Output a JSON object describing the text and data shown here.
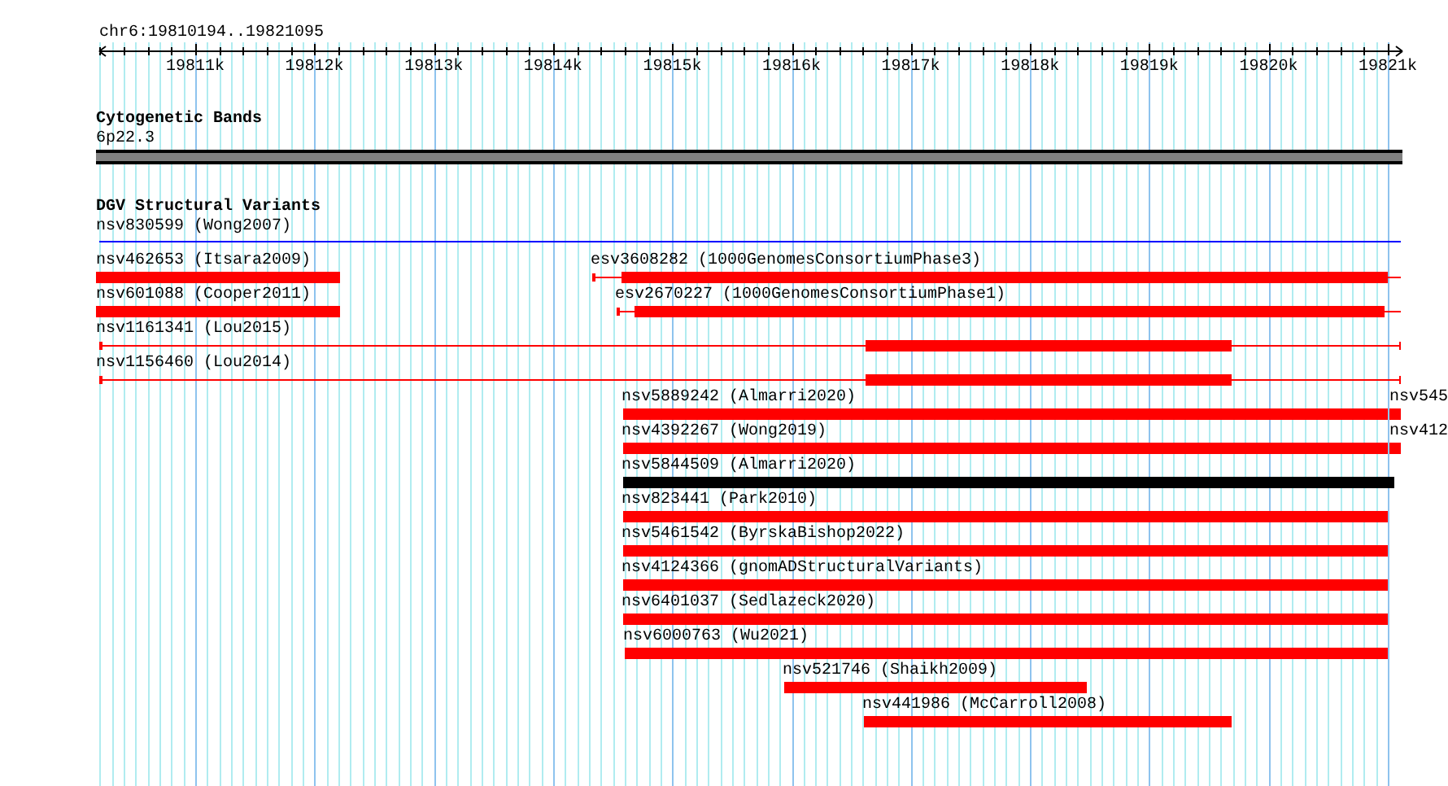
{
  "ruler": {
    "title": "chr6:19810194..19821095",
    "ticks": [
      "19811k",
      "19812k",
      "19813k",
      "19814k",
      "19815k",
      "19816k",
      "19817k",
      "19818k",
      "19819k",
      "19820k",
      "19821k"
    ]
  },
  "cytogenetic_bands": {
    "title": "Cytogenetic Bands",
    "band": "6p22.3"
  },
  "structural_variants": {
    "title": "DGV Structural Variants",
    "features": [
      {
        "label": "nsv830599 (Wong2007)",
        "color": "#0000ff"
      },
      {
        "label": "nsv462653 (Itsara2009)",
        "color": "#ff0000"
      },
      {
        "label": "esv3608282 (1000GenomesConsortiumPhase3)",
        "color": "#ff0000"
      },
      {
        "label": "nsv601088 (Cooper2011)",
        "color": "#ff0000"
      },
      {
        "label": "esv2670227 (1000GenomesConsortiumPhase1)",
        "color": "#ff0000"
      },
      {
        "label": "nsv1161341 (Lou2015)",
        "color": "#ff0000"
      },
      {
        "label": "nsv1156460 (Lou2014)",
        "color": "#ff0000"
      },
      {
        "label": "nsv5889242 (Almarri2020)",
        "color": "#ff0000"
      },
      {
        "label": "nsv545",
        "color": "#ff0000"
      },
      {
        "label": "nsv4392267 (Wong2019)",
        "color": "#ff0000"
      },
      {
        "label": "nsv412",
        "color": "#ff0000"
      },
      {
        "label": "nsv5844509 (Almarri2020)",
        "color": "#000000"
      },
      {
        "label": "nsv823441 (Park2010)",
        "color": "#ff0000"
      },
      {
        "label": "nsv5461542 (ByrskaBishop2022)",
        "color": "#ff0000"
      },
      {
        "label": "nsv4124366 (gnomADStructuralVariants)",
        "color": "#ff0000"
      },
      {
        "label": "nsv6401037 (Sedlazeck2020)",
        "color": "#ff0000"
      },
      {
        "label": "nsv6000763 (Wu2021)",
        "color": "#ff0000"
      },
      {
        "label": "nsv521746 (Shaikh2009)",
        "color": "#ff0000"
      },
      {
        "label": "nsv441986 (McCarroll2008)",
        "color": "#ff0000"
      }
    ]
  }
}
